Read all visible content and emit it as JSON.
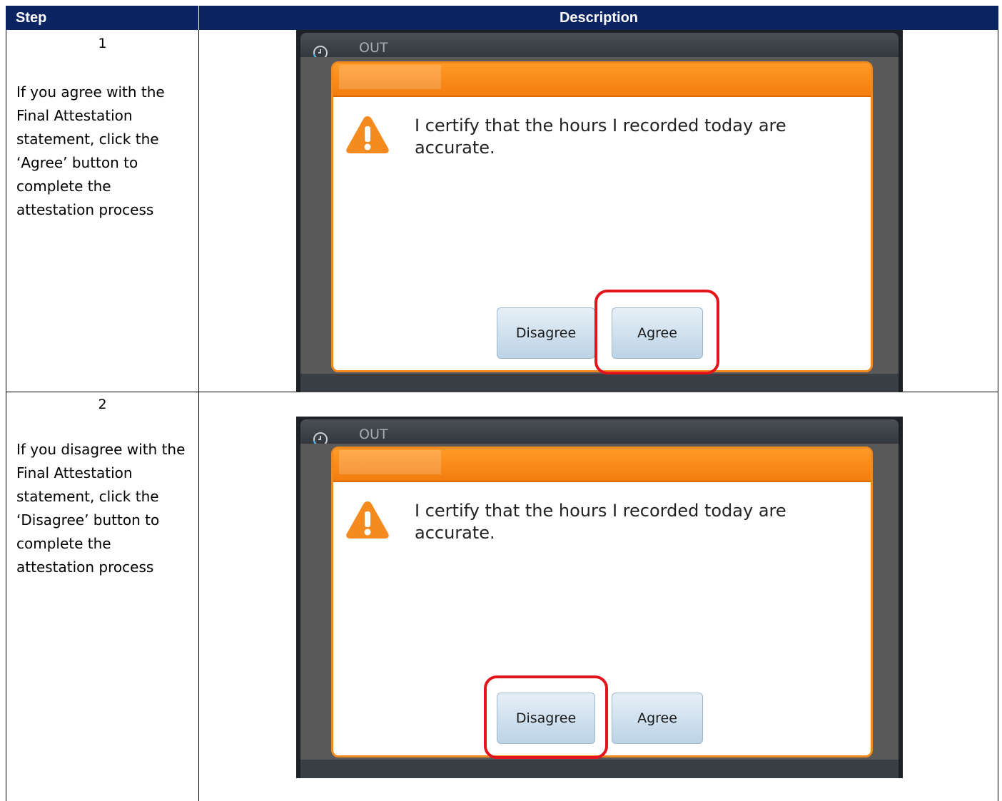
{
  "table": {
    "header": {
      "step": "Step",
      "description": "Description"
    },
    "rows": [
      {
        "step": "1",
        "instruction": "If you agree with the Final Attestation statement, click the ‘Agree’ button to complete the attestation process",
        "highlighted_button": "Agree"
      },
      {
        "step": "2",
        "instruction": "If you disagree with the Final Attestation statement, click the ‘Disagree’ button to complete the attestation process",
        "highlighted_button": "Disagree"
      }
    ]
  },
  "screen": {
    "status_label": "OUT",
    "dialog_message": "I certify that the hours I recorded today are accurate.",
    "disagree_label": "Disagree",
    "agree_label": "Agree"
  },
  "colors": {
    "header_bg": "#0c2462",
    "dialog_accent": "#f08a1e",
    "highlight": "#e3141b",
    "button_bg": "#c7dae9"
  },
  "icons": [
    "clock-icon",
    "warning-icon"
  ]
}
